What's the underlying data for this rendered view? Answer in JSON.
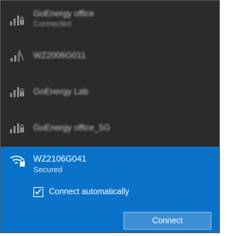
{
  "networks": [
    {
      "name": "GoEnergy office",
      "status": "Connected",
      "icon": "wifi-secured-icon"
    },
    {
      "name": "WZ2006G011",
      "status": "",
      "icon": "wifi-weak-icon"
    },
    {
      "name": "GoEnergy Lab",
      "status": "",
      "icon": "wifi-secured-icon"
    },
    {
      "name": "GoEnergy office_5G",
      "status": "",
      "icon": "wifi-secured-icon"
    }
  ],
  "selected_network": {
    "name": "WZ2106G041",
    "status": "Secured",
    "icon": "wifi-secured-icon",
    "connect_automatically_label": "Connect automatically",
    "connect_automatically_checked": true,
    "connect_button_label": "Connect"
  },
  "colors": {
    "flyout_background": "#2b2b2b",
    "selected_background": "#0a73c9",
    "button_background": "#3d8fd4"
  }
}
